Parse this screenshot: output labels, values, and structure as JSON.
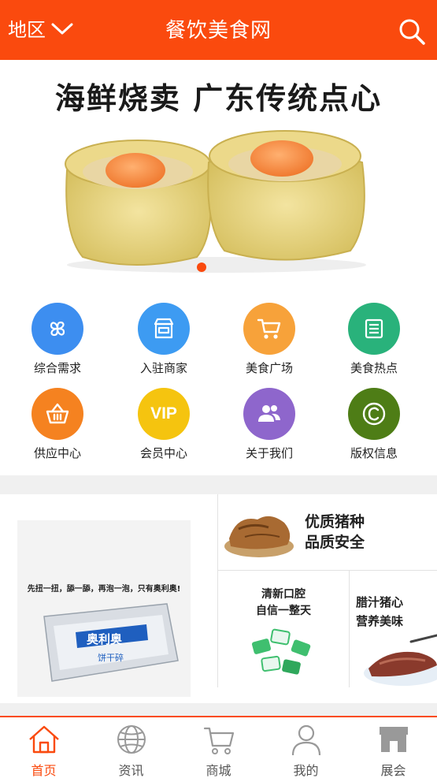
{
  "header": {
    "region_label": "地区",
    "title": "餐饮美食网",
    "region_icon": "chevron-down-icon",
    "search_icon": "search-icon"
  },
  "banner": {
    "caption": "海鲜烧卖  广东传统点心",
    "slide_count": 1,
    "active_slide": 1
  },
  "grid": {
    "items": [
      {
        "label": "综合需求",
        "icon": "flower-grid-icon",
        "color": "#3d8ef0"
      },
      {
        "label": "入驻商家",
        "icon": "storefront-icon",
        "color": "#3d9bf2"
      },
      {
        "label": "美食广场",
        "icon": "cart-icon",
        "color": "#f7a23a"
      },
      {
        "label": "美食热点",
        "icon": "document-list-icon",
        "color": "#29b27b"
      },
      {
        "label": "供应中心",
        "icon": "basket-icon",
        "color": "#f58220"
      },
      {
        "label": "会员中心",
        "icon": "vip-badge-icon",
        "color": "#f5c40f",
        "text": "VIP"
      },
      {
        "label": "关于我们",
        "icon": "people-icon",
        "color": "#8e66cc"
      },
      {
        "label": "版权信息",
        "icon": "copyright-icon",
        "color": "#4e7d16"
      }
    ]
  },
  "promo": {
    "left_caption": "先扭一扭，舔一舔，再泡一泡，只有奥利奥!",
    "left_brand": "奥利奥",
    "left_sub": "饼干碎",
    "top_right": {
      "line1": "优质猪种",
      "line2": "品质安全"
    },
    "bottom_mid": {
      "line1": "清新口腔",
      "line2": "自信一整天"
    },
    "bottom_right": {
      "line1": "腊汁猪心",
      "line2": "营养美味"
    }
  },
  "nav": {
    "items": [
      {
        "label": "首页",
        "icon": "home-icon",
        "active": true
      },
      {
        "label": "资讯",
        "icon": "globe-icon",
        "active": false
      },
      {
        "label": "商城",
        "icon": "cart-icon",
        "active": false
      },
      {
        "label": "我的",
        "icon": "user-icon",
        "active": false
      },
      {
        "label": "展会",
        "icon": "shop-icon",
        "active": false
      }
    ]
  },
  "colors": {
    "accent": "#fa4a0e",
    "nav_inactive": "#555555"
  }
}
